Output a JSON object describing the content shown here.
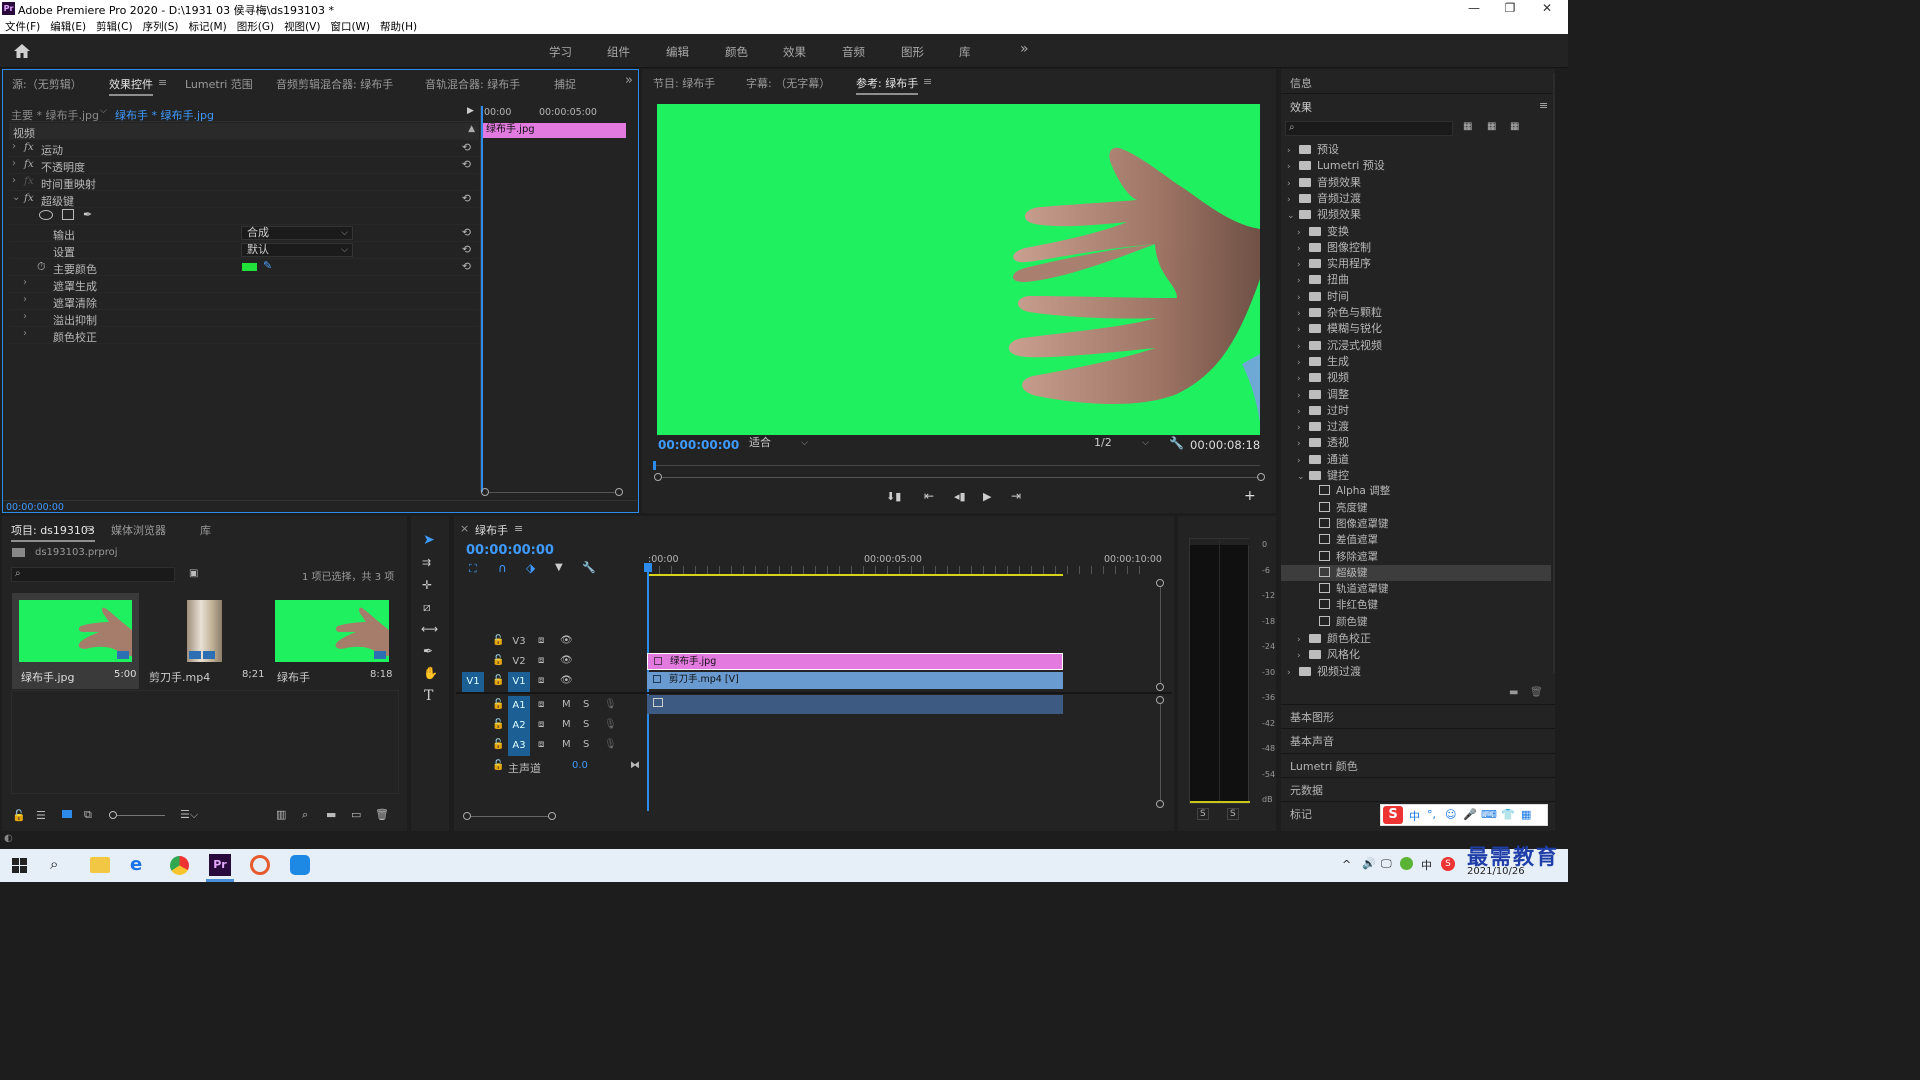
{
  "window": {
    "title": "Adobe Premiere Pro 2020 - D:\\1931 03 侯寻梅\\ds193103 *",
    "logo_text": "Pr",
    "controls": [
      "—",
      "❐",
      "✕"
    ]
  },
  "menu": [
    "文件(F)",
    "编辑(E)",
    "剪辑(C)",
    "序列(S)",
    "标记(M)",
    "图形(G)",
    "视图(V)",
    "窗口(W)",
    "帮助(H)"
  ],
  "workspaces": [
    "学习",
    "组件",
    "编辑",
    "颜色",
    "效果",
    "音频",
    "图形",
    "库"
  ],
  "workspaces_more": "»",
  "effect_controls": {
    "tabs": [
      "源:（无剪辑）",
      "效果控件",
      "Lumetri 范围",
      "音频剪辑混合器: 绿布手",
      "音轨混合器: 绿布手",
      "捕捉"
    ],
    "tab_menu": "≡",
    "tabs_more": "»",
    "master_label": "主要 * 绿布手.jpg",
    "clip_label": "绿布手 * 绿布手.jpg",
    "ruler_start": "00:00",
    "ruler_mid": "00:00:05:00",
    "mini_clip": "绿布手.jpg",
    "section_video": "视频",
    "effects": [
      {
        "name": "运动",
        "fx": true
      },
      {
        "name": "不透明度",
        "fx": true
      },
      {
        "name": "时间重映射",
        "fx": false
      },
      {
        "name": "超级键",
        "fx": true
      }
    ],
    "params": {
      "output_label": "输出",
      "output_value": "合成",
      "setting_label": "设置",
      "setting_value": "默认",
      "key_color_label": "主要颜色",
      "key_color": "#22e03a"
    },
    "subgroups": [
      "遮罩生成",
      "遮罩清除",
      "溢出抑制",
      "颜色校正"
    ],
    "timecode": "00:00:00:00"
  },
  "program": {
    "tabs": [
      "节目: 绿布手",
      "字幕: （无字幕）",
      "参考: 绿布手"
    ],
    "tab_menu": "≡",
    "timecode": "00:00:00:00",
    "fit": "适合",
    "resolution": "1/2",
    "duration": "00:00:08:18",
    "screen_color": "#1ff05f"
  },
  "effects_panel": {
    "info_tab": "信息",
    "title": "效果",
    "menu_icon": "≡",
    "search_placeholder": "",
    "tree": [
      {
        "label": "预设",
        "level": 0,
        "open": false,
        "type": "folder"
      },
      {
        "label": "Lumetri 预设",
        "level": 0,
        "open": false,
        "type": "folder"
      },
      {
        "label": "音频效果",
        "level": 0,
        "open": false,
        "type": "folder"
      },
      {
        "label": "音频过渡",
        "level": 0,
        "open": false,
        "type": "folder"
      },
      {
        "label": "视频效果",
        "level": 0,
        "open": true,
        "type": "folder"
      },
      {
        "label": "变换",
        "level": 1,
        "open": false,
        "type": "folder"
      },
      {
        "label": "图像控制",
        "level": 1,
        "open": false,
        "type": "folder"
      },
      {
        "label": "实用程序",
        "level": 1,
        "open": false,
        "type": "folder"
      },
      {
        "label": "扭曲",
        "level": 1,
        "open": false,
        "type": "folder"
      },
      {
        "label": "时间",
        "level": 1,
        "open": false,
        "type": "folder"
      },
      {
        "label": "杂色与颗粒",
        "level": 1,
        "open": false,
        "type": "folder"
      },
      {
        "label": "模糊与锐化",
        "level": 1,
        "open": false,
        "type": "folder"
      },
      {
        "label": "沉浸式视频",
        "level": 1,
        "open": false,
        "type": "folder"
      },
      {
        "label": "生成",
        "level": 1,
        "open": false,
        "type": "folder"
      },
      {
        "label": "视频",
        "level": 1,
        "open": false,
        "type": "folder"
      },
      {
        "label": "调整",
        "level": 1,
        "open": false,
        "type": "folder"
      },
      {
        "label": "过时",
        "level": 1,
        "open": false,
        "type": "folder"
      },
      {
        "label": "过渡",
        "level": 1,
        "open": false,
        "type": "folder"
      },
      {
        "label": "透视",
        "level": 1,
        "open": false,
        "type": "folder"
      },
      {
        "label": "通道",
        "level": 1,
        "open": false,
        "type": "folder"
      },
      {
        "label": "键控",
        "level": 1,
        "open": true,
        "type": "folder"
      },
      {
        "label": "Alpha 调整",
        "level": 2,
        "type": "effect"
      },
      {
        "label": "亮度键",
        "level": 2,
        "type": "effect"
      },
      {
        "label": "图像遮罩键",
        "level": 2,
        "type": "effect"
      },
      {
        "label": "差值遮罩",
        "level": 2,
        "type": "effect"
      },
      {
        "label": "移除遮罩",
        "level": 2,
        "type": "effect"
      },
      {
        "label": "超级键",
        "level": 2,
        "type": "effect",
        "selected": true
      },
      {
        "label": "轨道遮罩键",
        "level": 2,
        "type": "effect"
      },
      {
        "label": "非红色键",
        "level": 2,
        "type": "effect"
      },
      {
        "label": "颜色键",
        "level": 2,
        "type": "effect"
      },
      {
        "label": "颜色校正",
        "level": 1,
        "open": false,
        "type": "folder"
      },
      {
        "label": "风格化",
        "level": 1,
        "open": false,
        "type": "folder"
      },
      {
        "label": "视频过渡",
        "level": 0,
        "open": false,
        "type": "folder"
      }
    ],
    "other_panels": [
      "基本图形",
      "基本声音",
      "Lumetri 颜色",
      "元数据",
      "标记"
    ]
  },
  "project": {
    "tabs": [
      "项目: ds193103",
      "媒体浏览器",
      "库"
    ],
    "tab_menu": "≡",
    "file": "ds193103.prproj",
    "selection_info": "1 项已选择，共 3 项",
    "items": [
      {
        "name": "绿布手.jpg",
        "duration": "5:00",
        "kind": "green"
      },
      {
        "name": "剪刀手.mp4",
        "duration": "8;21",
        "kind": "video"
      },
      {
        "name": "绿布手",
        "duration": "8:18",
        "kind": "green"
      }
    ]
  },
  "timeline": {
    "tab": "绿布手",
    "tab_menu": "≡",
    "close": "×",
    "timecode": "00:00:00:00",
    "ruler": [
      ":00:00",
      "00:00:05:00",
      "00:00:10:00"
    ],
    "video_tracks": [
      "V3",
      "V2",
      "V1"
    ],
    "audio_tracks": [
      "A1",
      "A2",
      "A3"
    ],
    "source_patch_video": "V1",
    "master_label": "主声道",
    "master_value": "0.0",
    "clips": {
      "v2": "绿布手.jpg",
      "v1": "剪刀手.mp4 [V]"
    }
  },
  "meter": {
    "scale": [
      "0",
      "-6",
      "-12",
      "-18",
      "-24",
      "-30",
      "-36",
      "-42",
      "-48",
      "-54",
      "dB"
    ],
    "solo_labels": [
      "S",
      "S"
    ]
  },
  "ime": {
    "items": [
      "中",
      "°,",
      "☺",
      "🎤",
      "⌨",
      "👕",
      "▦"
    ]
  },
  "taskbar": {
    "date": "2021/10/26",
    "watermark": "最需教育",
    "tray": [
      "^",
      "🔊",
      "🖵",
      "中"
    ]
  },
  "colors": {
    "accent_blue": "#2d8ceb",
    "timecode_blue": "#3e9aff",
    "clip_pink": "#e27ae0",
    "clip_blue": "#6a9bd0",
    "green_screen": "#1ff05f"
  }
}
